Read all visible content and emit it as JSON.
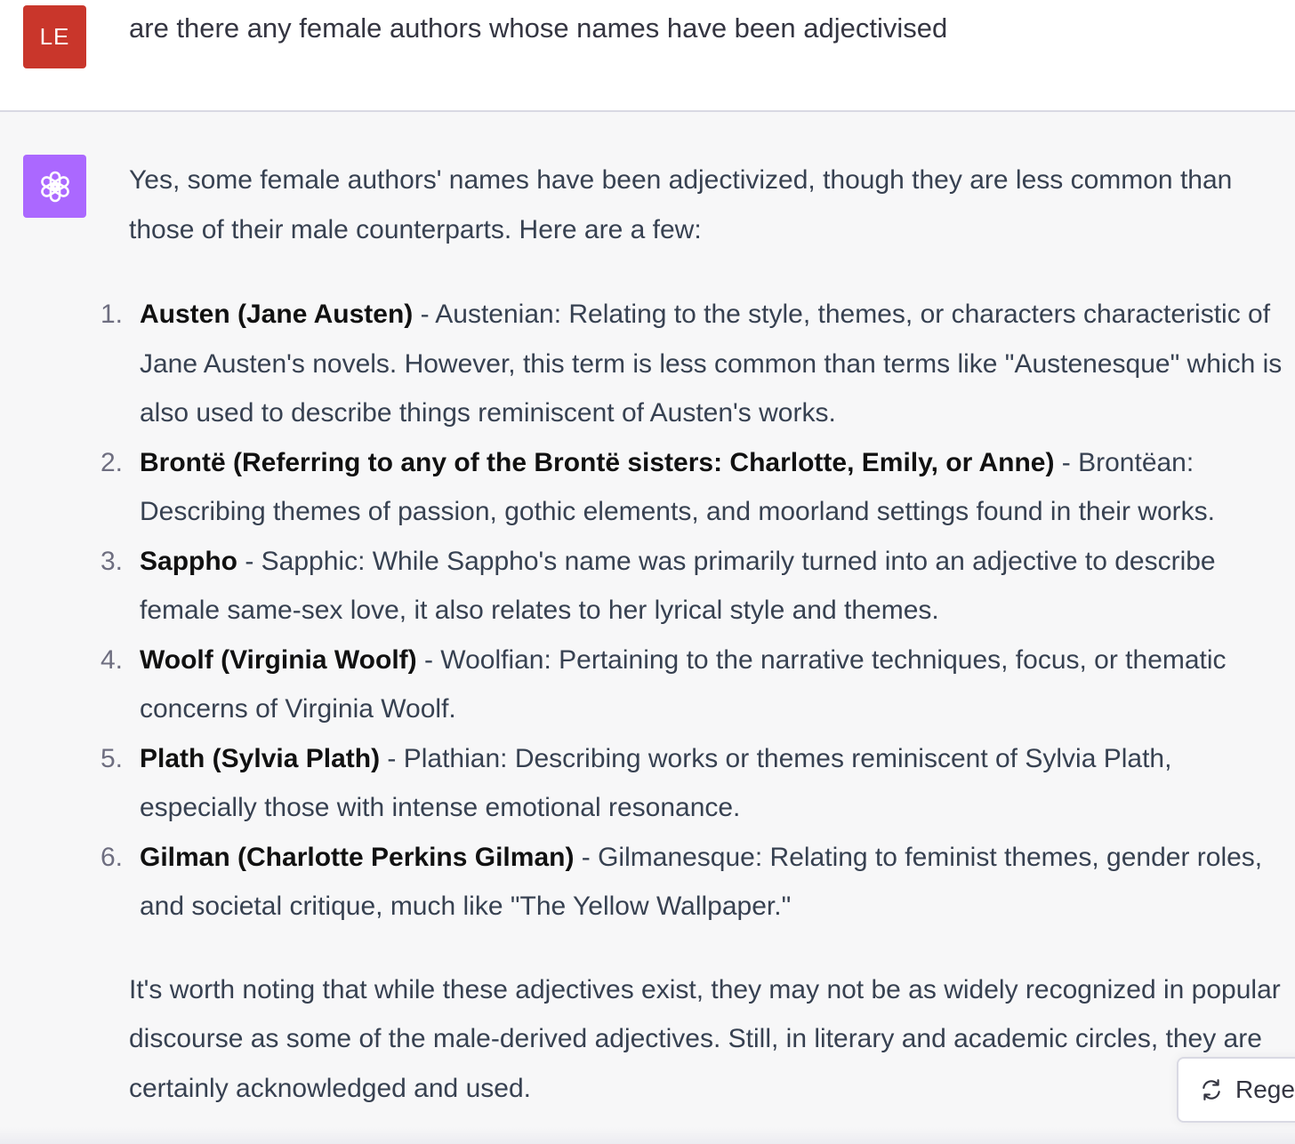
{
  "user": {
    "avatar_initials": "LE",
    "avatar_color": "#c9362b",
    "message": "are there any female authors whose names have been adjectivised"
  },
  "assistant": {
    "avatar_icon": "openai-logo-icon",
    "avatar_color": "#ab68ff",
    "intro": "Yes, some female authors' names have been adjectivized, though they are less common than those of their male counterparts. Here are a few:",
    "items": [
      {
        "number": "1.",
        "term": "Austen (Jane Austen)",
        "description": " - Austenian: Relating to the style, themes, or characters characteristic of Jane Austen's novels. However, this term is less common than terms like \"Austenesque\" which is also used to describe things reminiscent of Austen's works."
      },
      {
        "number": "2.",
        "term": "Brontë (Referring to any of the Brontë sisters: Charlotte, Emily, or Anne)",
        "description": " - Brontëan: Describing themes of passion, gothic elements, and moorland settings found in their works."
      },
      {
        "number": "3.",
        "term": "Sappho",
        "description": " - Sapphic: While Sappho's name was primarily turned into an adjective to describe female same-sex love, it also relates to her lyrical style and themes."
      },
      {
        "number": "4.",
        "term": "Woolf (Virginia Woolf)",
        "description": " - Woolfian: Pertaining to the narrative techniques, focus, or thematic concerns of Virginia Woolf."
      },
      {
        "number": "5.",
        "term": "Plath (Sylvia Plath)",
        "description": " - Plathian: Describing works or themes reminiscent of Sylvia Plath, especially those with intense emotional resonance."
      },
      {
        "number": "6.",
        "term": "Gilman (Charlotte Perkins Gilman)",
        "description": " - Gilmanesque: Relating to feminist themes, gender roles, and societal critique, much like \"The Yellow Wallpaper.\""
      }
    ],
    "conclusion": "It's worth noting that while these adjectives exist, they may not be as widely recognized in popular discourse as some of the male-derived adjectives. Still, in literary and academic circles, they are certainly acknowledged and used."
  },
  "regenerate": {
    "label": "Regenerate",
    "icon": "refresh-icon"
  }
}
